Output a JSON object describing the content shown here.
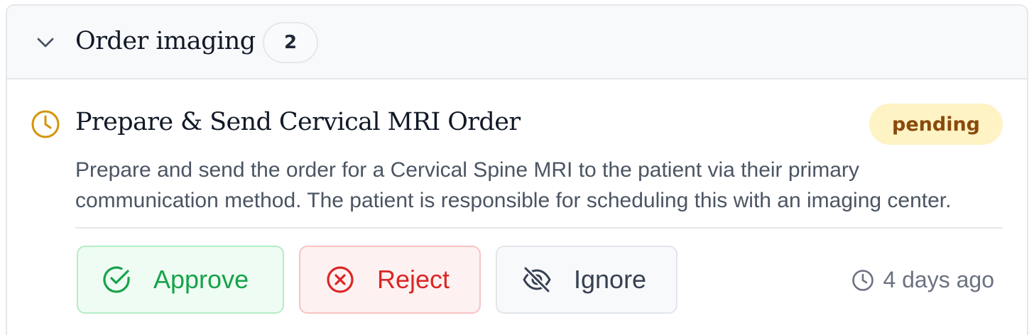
{
  "section": {
    "title": "Order imaging",
    "count": "2",
    "toggle_icon": "chevron-down-icon"
  },
  "task": {
    "status_icon": "clock-icon",
    "title": "Prepare & Send Cervical MRI Order",
    "status": "pending",
    "description": "Prepare and send the order for a Cervical Spine MRI to the patient via their primary communication method. The patient is responsible for scheduling this with an imaging center.",
    "timestamp": "4 days ago"
  },
  "actions": {
    "approve": {
      "label": "Approve",
      "icon": "check-circle-icon"
    },
    "reject": {
      "label": "Reject",
      "icon": "x-circle-icon"
    },
    "ignore": {
      "label": "Ignore",
      "icon": "eye-off-icon"
    }
  },
  "colors": {
    "pending_bg": "#fdf3c4",
    "pending_text": "#8a4a0c",
    "clock_accent": "#d4940a",
    "approve": "#16a34a",
    "reject": "#dc2626",
    "neutral": "#374151"
  }
}
